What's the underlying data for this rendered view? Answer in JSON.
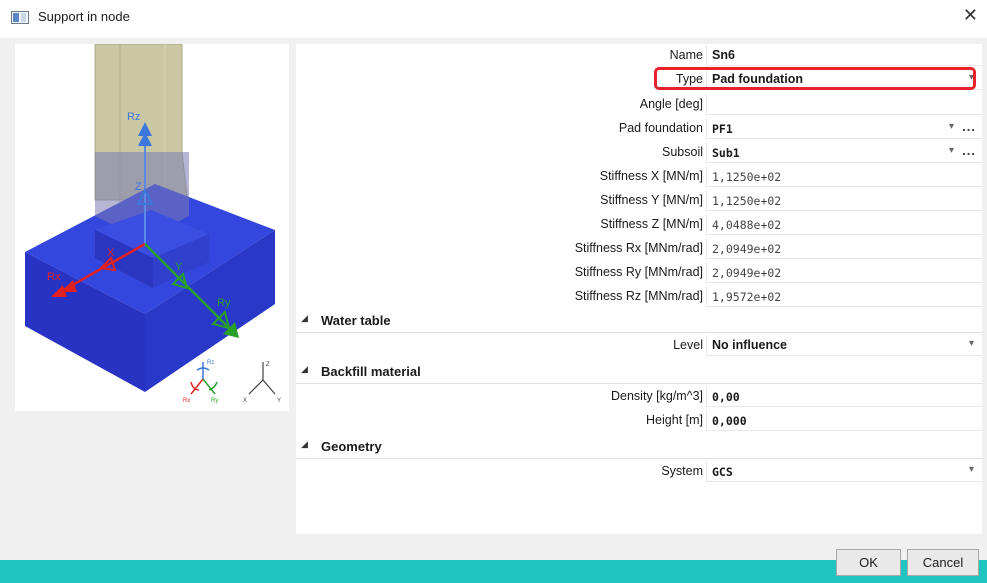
{
  "window": {
    "title": "Support in node",
    "close_glyph": "✕"
  },
  "preview": {
    "axis_labels": {
      "rz": "Rz",
      "z": "Z",
      "rx": "Rx",
      "x": "X",
      "y": "Y",
      "ry": "Ry"
    },
    "triad_local": {
      "rz": "Rz",
      "rx": "Rx",
      "ry": "Ry"
    },
    "triad_global": {
      "z": "Z",
      "x": "X",
      "y": "Y"
    },
    "colors": {
      "foundation": "#2c3ad8",
      "x_axis": "#e32020",
      "y_axis": "#28a028",
      "z_axis": "#3c78dc",
      "column": "#c8c8a0"
    }
  },
  "properties": {
    "name": {
      "label": "Name",
      "value": "Sn6"
    },
    "type": {
      "label": "Type",
      "value": "Pad foundation"
    },
    "angle": {
      "label": "Angle [deg]",
      "value": ""
    },
    "pad_foundation": {
      "label": "Pad foundation",
      "value": "PF1"
    },
    "subsoil": {
      "label": "Subsoil",
      "value": "Sub1"
    },
    "stiffness_x": {
      "label": "Stiffness X [MN/m]",
      "value": "1,1250e+02"
    },
    "stiffness_y": {
      "label": "Stiffness Y [MN/m]",
      "value": "1,1250e+02"
    },
    "stiffness_z": {
      "label": "Stiffness Z [MN/m]",
      "value": "4,0488e+02"
    },
    "stiffness_rx": {
      "label": "Stiffness Rx [MNm/rad]",
      "value": "2,0949e+02"
    },
    "stiffness_ry": {
      "label": "Stiffness Ry [MNm/rad]",
      "value": "2,0949e+02"
    },
    "stiffness_rz": {
      "label": "Stiffness Rz [MNm/rad]",
      "value": "1,9572e+02"
    }
  },
  "sections": {
    "water_table": {
      "title": "Water table",
      "level": {
        "label": "Level",
        "value": "No influence"
      }
    },
    "backfill": {
      "title": "Backfill material",
      "density": {
        "label": "Density [kg/m^3]",
        "value": "0,00"
      },
      "height": {
        "label": "Height [m]",
        "value": "0,000"
      }
    },
    "geometry": {
      "title": "Geometry",
      "system": {
        "label": "System",
        "value": "GCS"
      }
    }
  },
  "icons": {
    "dropdown": "chevron-down",
    "ellipsis": "…",
    "collapse": "◢"
  },
  "glyphs": {
    "dropdown": "▾",
    "ellipsis": "...",
    "collapse": "◢"
  },
  "buttons": {
    "ok": "OK",
    "cancel": "Cancel"
  },
  "accent": {
    "highlight": "#e8222a",
    "status_bar": "#20c4c0"
  }
}
